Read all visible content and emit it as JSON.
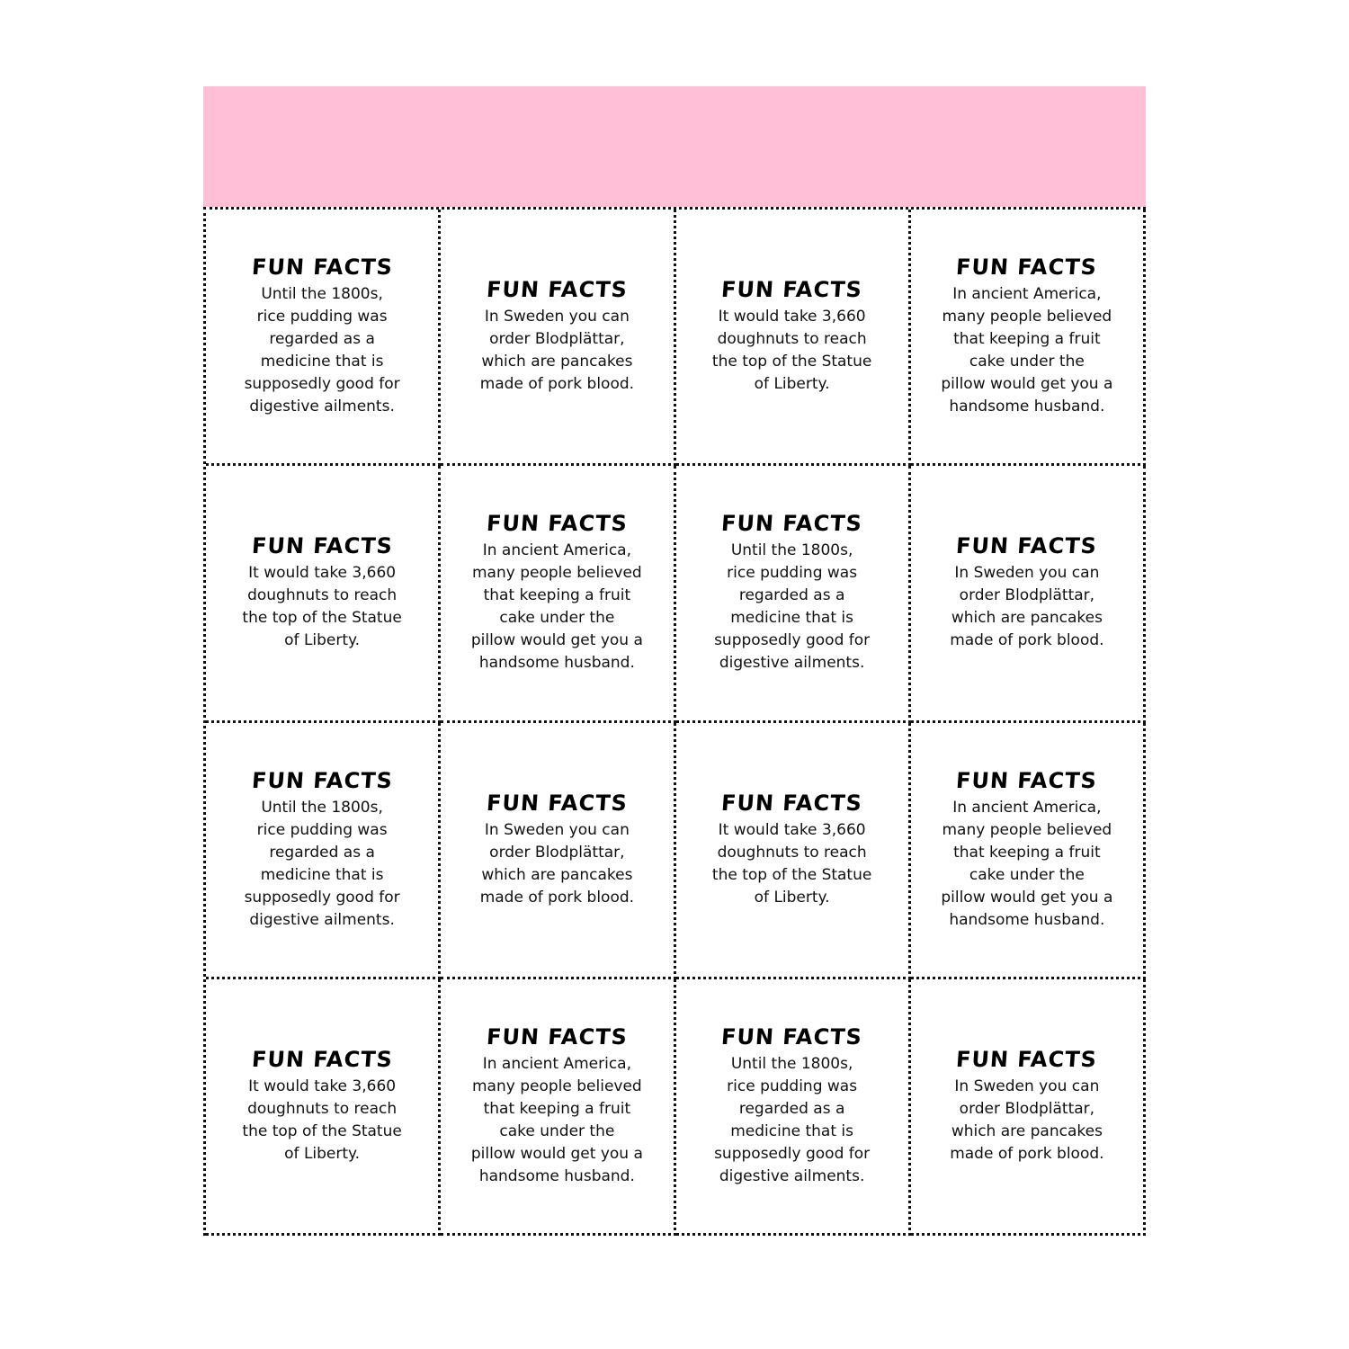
{
  "header": {
    "banner_color": "#ffbfd6"
  },
  "cards": [
    {
      "title": "FUN FACTS",
      "text": "Until the 1800s,\nrice pudding was\nregarded as a\nmedicine that is\nsupposedly good for\ndigestive ailments."
    },
    {
      "title": "FUN FACTS",
      "text": "In Sweden you can\norder Blodplättar,\nwhich are pancakes\nmade of pork blood."
    },
    {
      "title": "FUN FACTS",
      "text": "It would take 3,660\ndoughnuts to reach\nthe top of the Statue\nof Liberty."
    },
    {
      "title": "FUN FACTS",
      "text": "In ancient America,\nmany people believed\nthat keeping a fruit\ncake under the\npillow would get you a\nhandsome husband."
    },
    {
      "title": "FUN FACTS",
      "text": "It would take 3,660\ndoughnuts to reach\nthe top of the Statue\nof Liberty."
    },
    {
      "title": "FUN FACTS",
      "text": "In ancient America,\nmany people believed\nthat keeping a fruit\ncake under the\npillow would get you a\nhandsome husband."
    },
    {
      "title": "FUN FACTS",
      "text": "Until the 1800s,\nrice pudding was\nregarded as a\nmedicine that is\nsupposedly good for\ndigestive ailments."
    },
    {
      "title": "FUN FACTS",
      "text": "In Sweden you can\norder Blodplättar,\nwhich are pancakes\nmade of pork blood."
    },
    {
      "title": "FUN FACTS",
      "text": "Until the 1800s,\nrice pudding was\nregarded as a\nmedicine that is\nsupposedly good for\ndigestive ailments."
    },
    {
      "title": "FUN FACTS",
      "text": "In Sweden you can\norder Blodplättar,\nwhich are pancakes\nmade of pork blood."
    },
    {
      "title": "FUN FACTS",
      "text": "It would take 3,660\ndoughnuts to reach\nthe top of the Statue\nof Liberty."
    },
    {
      "title": "FUN FACTS",
      "text": "In ancient America,\nmany people believed\nthat keeping a fruit\ncake under the\npillow would get you a\nhandsome husband."
    },
    {
      "title": "FUN FACTS",
      "text": "It would take 3,660\ndoughnuts to reach\nthe top of the Statue\nof Liberty."
    },
    {
      "title": "FUN FACTS",
      "text": "In ancient America,\nmany people believed\nthat keeping a fruit\ncake under the\npillow would get you a\nhandsome husband."
    },
    {
      "title": "FUN FACTS",
      "text": "Until the 1800s,\nrice pudding was\nregarded as a\nmedicine that is\nsupposedly good for\ndigestive ailments."
    },
    {
      "title": "FUN FACTS",
      "text": "In Sweden you can\norder Blodplättar,\nwhich are pancakes\nmade of pork blood."
    }
  ]
}
